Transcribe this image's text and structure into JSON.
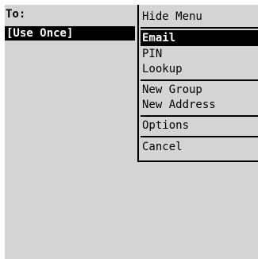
{
  "compose": {
    "to_label": "To:",
    "address_value": "[Use Once]"
  },
  "menu": {
    "hide_label": "Hide Menu",
    "items": [
      {
        "label": "Email",
        "selected": true
      },
      {
        "label": "PIN"
      },
      {
        "label": "Lookup"
      },
      {
        "label": "New Group"
      },
      {
        "label": "New Address"
      },
      {
        "label": "Options"
      },
      {
        "label": "Cancel"
      }
    ]
  },
  "colors": {
    "screen_background": "#d4d4d4",
    "highlight_background": "#000000",
    "highlight_text": "#ffffff"
  }
}
